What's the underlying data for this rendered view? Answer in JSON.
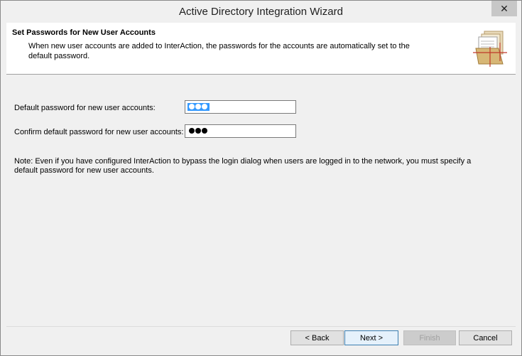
{
  "window": {
    "title": "Active Directory Integration Wizard",
    "close_glyph": "✕"
  },
  "header": {
    "title": "Set Passwords for New User Accounts",
    "description": "When new user accounts are added to InterAction, the passwords for the accounts are automatically set to the default password.",
    "icon": "folder-documents-icon"
  },
  "form": {
    "default_password_label": "Default password for new user accounts:",
    "confirm_password_label": "Confirm default password for new user accounts:",
    "default_password_length": 3,
    "confirm_password_length": 3
  },
  "note": "Note: Even if you have configured InterAction to bypass the login dialog when users are logged in to the network, you must specify a default password for new user accounts.",
  "buttons": {
    "back": "< Back",
    "next": "Next >",
    "finish": "Finish",
    "cancel": "Cancel"
  },
  "colors": {
    "selection": "#3399ff",
    "header_bg": "#ffffff",
    "dialog_bg": "#f0f0f0"
  }
}
